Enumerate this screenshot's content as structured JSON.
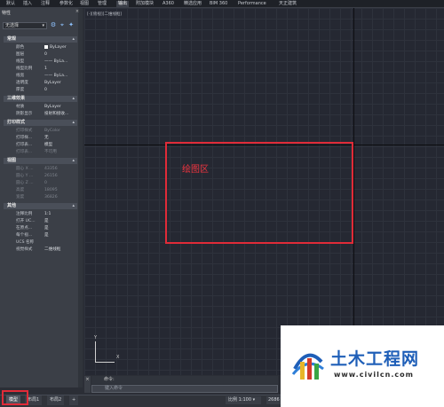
{
  "ribbon": {
    "tabs": [
      {
        "label": "默认",
        "active": false
      },
      {
        "label": "插入",
        "active": false
      },
      {
        "label": "注释",
        "active": false
      },
      {
        "label": "参数化",
        "active": false
      },
      {
        "label": "视图",
        "active": false
      },
      {
        "label": "管理",
        "active": false
      },
      {
        "label": "输出",
        "active": true
      },
      {
        "label": "附加模块",
        "active": false
      },
      {
        "label": "A360",
        "active": false
      },
      {
        "label": "精选应用",
        "active": false
      },
      {
        "label": "BIM 360",
        "active": false
      },
      {
        "label": "Performance",
        "active": false
      },
      {
        "label": "天正建筑",
        "active": false
      }
    ]
  },
  "palette": {
    "title": "特性",
    "close": "×",
    "selection": "无选择",
    "tool_icons": [
      "quick-select-icon",
      "select-objects-icon",
      "toggle-pickadd-icon"
    ],
    "sections": [
      {
        "title": "常规",
        "rows": [
          {
            "label": "颜色",
            "value": "ByLayer",
            "swatch": true
          },
          {
            "label": "图层",
            "value": "0"
          },
          {
            "label": "线型",
            "value": "—— ByLa..."
          },
          {
            "label": "线型比例",
            "value": "1"
          },
          {
            "label": "线宽",
            "value": "—— ByLa..."
          },
          {
            "label": "透明度",
            "value": "ByLayer"
          },
          {
            "label": "厚度",
            "value": "0"
          }
        ]
      },
      {
        "title": "三维效果",
        "rows": [
          {
            "label": "材质",
            "value": "ByLayer"
          },
          {
            "label": "阴影显示",
            "value": "投射和接收..."
          }
        ]
      },
      {
        "title": "打印样式",
        "rows": [
          {
            "label": "打印样式",
            "value": "ByColor",
            "dim": true
          },
          {
            "label": "打印样...",
            "value": "无"
          },
          {
            "label": "打印表...",
            "value": "模型"
          },
          {
            "label": "打印表...",
            "value": "不可用",
            "dim": true
          }
        ]
      },
      {
        "title": "视图",
        "rows": [
          {
            "label": "圆心 X ...",
            "value": "43356",
            "dim": true
          },
          {
            "label": "圆心 Y ...",
            "value": "26156",
            "dim": true
          },
          {
            "label": "圆心 Z ...",
            "value": "0",
            "dim": true
          },
          {
            "label": "高度",
            "value": "18095",
            "dim": true
          },
          {
            "label": "宽度",
            "value": "36826",
            "dim": true
          }
        ]
      },
      {
        "title": "其他",
        "rows": [
          {
            "label": "注释比例",
            "value": "1:1"
          },
          {
            "label": "打开 UC...",
            "value": "是"
          },
          {
            "label": "在原点...",
            "value": "是"
          },
          {
            "label": "每个视...",
            "value": "是"
          },
          {
            "label": "UCS 名称",
            "value": ""
          },
          {
            "label": "视觉样式",
            "value": "二维线框"
          }
        ]
      }
    ]
  },
  "canvas": {
    "viewport_label": "[-][俯视][二维线框]",
    "drawing_area_label": "绘图区",
    "ucs": {
      "y": "Y",
      "x": "X"
    }
  },
  "command": {
    "close": "×",
    "history": "命令:",
    "placeholder": "键入命令"
  },
  "layout_tabs": [
    {
      "label": "模型",
      "active": true
    },
    {
      "label": "布局1",
      "active": false
    },
    {
      "label": "布局2",
      "active": false
    },
    {
      "label": "+",
      "active": false
    }
  ],
  "status": {
    "scale": "比例 1:100 ▾",
    "coord": "2686"
  },
  "watermark": {
    "name": "土木工程网",
    "url": "www.civilcn.com"
  },
  "colors": {
    "highlight": "#e02b38",
    "canvas": "#252832",
    "watermark_blue": "#1f5fb8"
  }
}
